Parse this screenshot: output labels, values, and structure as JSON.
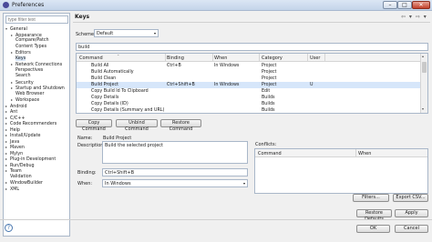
{
  "window": {
    "title": "Preferences",
    "minimize_symbol": "–",
    "maximize_symbol": "□",
    "close_symbol": "✕"
  },
  "sidebar": {
    "filter_placeholder": "type filter text",
    "items": [
      {
        "label": "General",
        "toggle": "▾",
        "indent": 0
      },
      {
        "label": "Appearance",
        "toggle": "▸",
        "indent": 1
      },
      {
        "label": "Compare/Patch",
        "toggle": "",
        "indent": 1
      },
      {
        "label": "Content Types",
        "toggle": "",
        "indent": 1
      },
      {
        "label": "Editors",
        "toggle": "▸",
        "indent": 1
      },
      {
        "label": "Keys",
        "toggle": "",
        "indent": 1,
        "selected": true
      },
      {
        "label": "Network Connections",
        "toggle": "▸",
        "indent": 1
      },
      {
        "label": "Perspectives",
        "toggle": "",
        "indent": 1
      },
      {
        "label": "Search",
        "toggle": "",
        "indent": 1
      },
      {
        "label": "Security",
        "toggle": "▸",
        "indent": 1
      },
      {
        "label": "Startup and Shutdown",
        "toggle": "▸",
        "indent": 1
      },
      {
        "label": "Web Browser",
        "toggle": "",
        "indent": 1
      },
      {
        "label": "Workspace",
        "toggle": "▸",
        "indent": 1
      },
      {
        "label": "Android",
        "toggle": "▸",
        "indent": 0
      },
      {
        "label": "Ant",
        "toggle": "▸",
        "indent": 0
      },
      {
        "label": "C/C++",
        "toggle": "▸",
        "indent": 0
      },
      {
        "label": "Code Recommenders",
        "toggle": "▸",
        "indent": 0
      },
      {
        "label": "Help",
        "toggle": "▸",
        "indent": 0
      },
      {
        "label": "Install/Update",
        "toggle": "▸",
        "indent": 0
      },
      {
        "label": "Java",
        "toggle": "▸",
        "indent": 0
      },
      {
        "label": "Maven",
        "toggle": "▸",
        "indent": 0
      },
      {
        "label": "Mylyn",
        "toggle": "▸",
        "indent": 0
      },
      {
        "label": "Plug-in Development",
        "toggle": "▸",
        "indent": 0
      },
      {
        "label": "Run/Debug",
        "toggle": "▸",
        "indent": 0
      },
      {
        "label": "Team",
        "toggle": "▸",
        "indent": 0
      },
      {
        "label": "Validation",
        "toggle": "",
        "indent": 0
      },
      {
        "label": "WindowBuilder",
        "toggle": "▸",
        "indent": 0
      },
      {
        "label": "XML",
        "toggle": "▸",
        "indent": 0
      }
    ]
  },
  "page": {
    "title": "Keys",
    "nav_arrows": "⇦ ▾ ⇨ ▾",
    "scheme_label": "Scheme:",
    "scheme_value": "Default",
    "search_value": "build"
  },
  "table": {
    "columns": [
      "Command",
      "Binding",
      "When",
      "Category",
      "User"
    ],
    "sort_indicator": "⌃",
    "rows": [
      {
        "command": "Build All",
        "binding": "Ctrl+B",
        "when": "In Windows",
        "category": "Project",
        "user": ""
      },
      {
        "command": "Build Automatically",
        "binding": "",
        "when": "",
        "category": "Project",
        "user": ""
      },
      {
        "command": "Build Clean",
        "binding": "",
        "when": "",
        "category": "Project",
        "user": ""
      },
      {
        "command": "Build Project",
        "binding": "Ctrl+Shift+B",
        "when": "In Windows",
        "category": "Project",
        "user": "U",
        "selected": true
      },
      {
        "command": "Copy Build Id To Clipboard",
        "binding": "",
        "when": "",
        "category": "Edit",
        "user": ""
      },
      {
        "command": "Copy Details",
        "binding": "",
        "when": "",
        "category": "Builds",
        "user": ""
      },
      {
        "command": "Copy Details (ID)",
        "binding": "",
        "when": "",
        "category": "Builds",
        "user": ""
      },
      {
        "command": "Copy Details (Summary and URL)",
        "binding": "",
        "when": "",
        "category": "Builds",
        "user": ""
      }
    ]
  },
  "buttons": {
    "copy_command": "Copy Command",
    "unbind_command": "Unbind Command",
    "restore_command": "Restore Command",
    "filters": "Filters...",
    "export_csv": "Export CSV...",
    "restore_defaults": "Restore Defaults",
    "apply": "Apply",
    "ok": "OK",
    "cancel": "Cancel"
  },
  "details": {
    "name_label": "Name:",
    "name_value": "Build Project",
    "description_label": "Description:",
    "description_value": "Build the selected project",
    "binding_label": "Binding:",
    "binding_value": "Ctrl+Shift+B",
    "when_label": "When:",
    "when_value": "In Windows"
  },
  "conflicts": {
    "label": "Conflicts:",
    "columns": [
      "Command",
      "When"
    ]
  },
  "help_symbol": "?"
}
